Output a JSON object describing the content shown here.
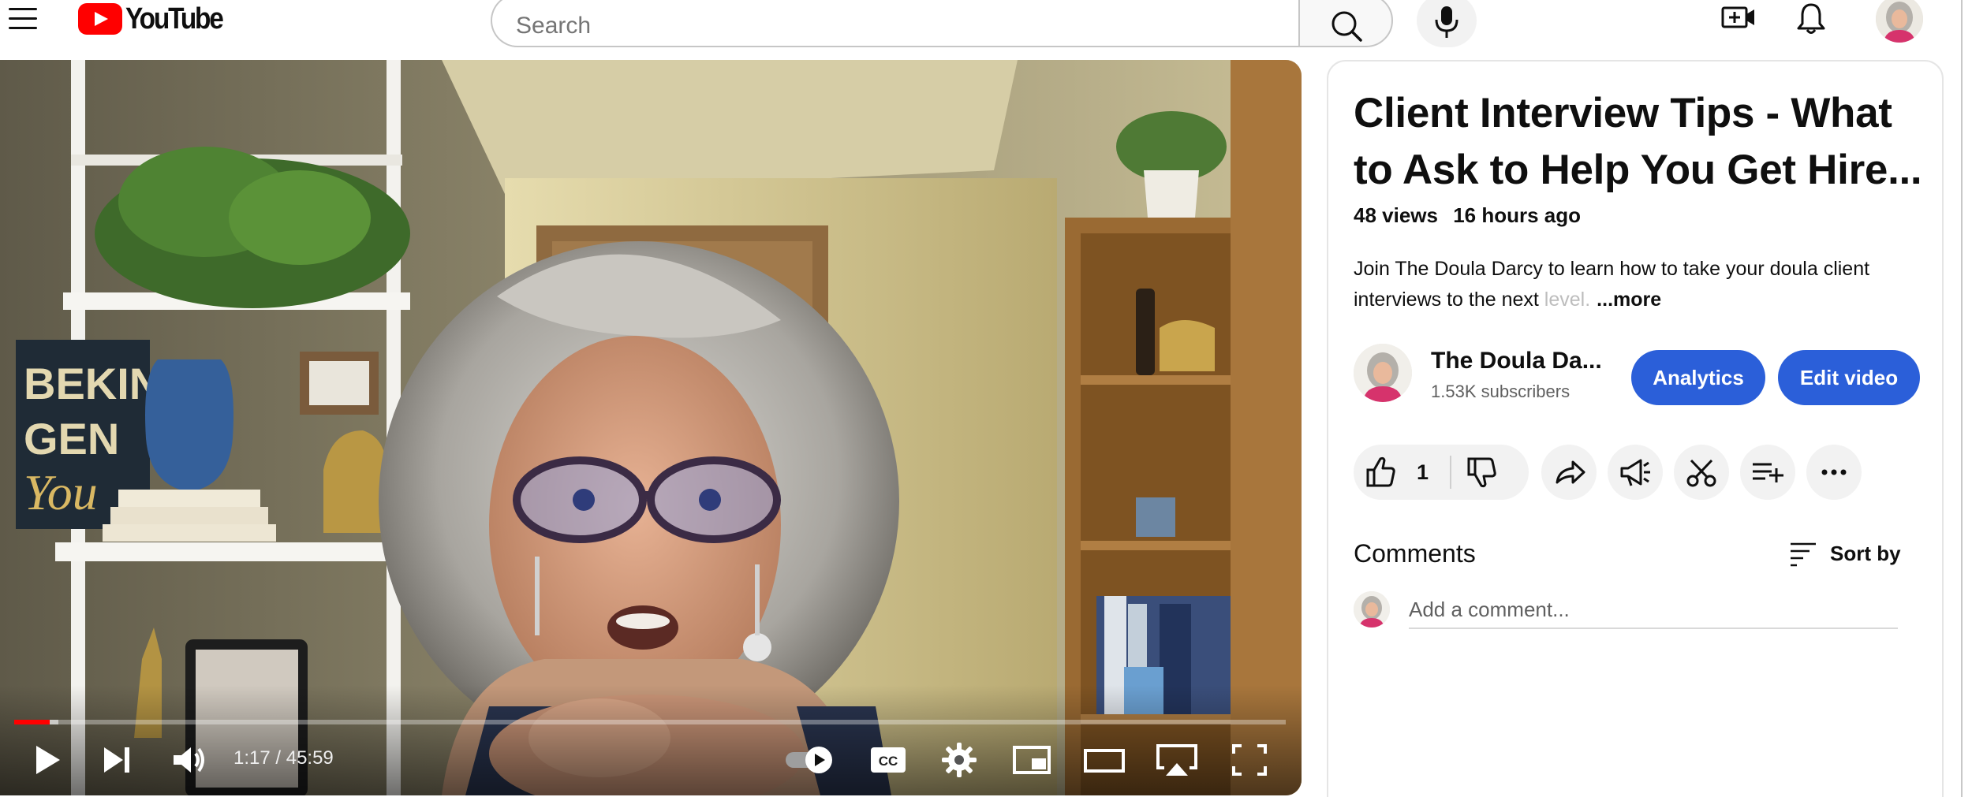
{
  "app": {
    "logo_text": "YouTube",
    "accent_color": "#ff0000",
    "brand_button_color": "#2b5fd9"
  },
  "header": {
    "search": {
      "placeholder": "Search",
      "value": ""
    },
    "icons": [
      "menu-icon",
      "search-icon",
      "microphone-icon",
      "create-video-icon",
      "notifications-bell-icon",
      "account-avatar"
    ]
  },
  "player": {
    "current_time": "1:17",
    "duration": "45:59",
    "time_display": "1:17 / 45:59",
    "played_fraction": 0.028,
    "buffered_fraction": 0.035,
    "autoplay_on": true,
    "controls": [
      "play-icon",
      "next-icon",
      "volume-icon",
      "autoplay-toggle",
      "captions-icon",
      "settings-gear-icon",
      "miniplayer-icon",
      "theater-mode-icon",
      "airplay-icon",
      "fullscreen-icon"
    ],
    "captions_label": "CC"
  },
  "video": {
    "title_line1": "Client Interview Tips - What",
    "title_line2": "to Ask to Help You Get Hire...",
    "views": "48 views",
    "uploaded": "16 hours ago",
    "description_visible": "Join The Doula Darcy to learn how to take your doula client interviews to the next ",
    "description_faded": "level.",
    "description_more": "...more"
  },
  "channel": {
    "name": "The Doula Da...",
    "subscribers": "1.53K subscribers",
    "analytics_label": "Analytics",
    "edit_label": "Edit video"
  },
  "actions": {
    "like_count": "1",
    "buttons": [
      "like-icon",
      "dislike-icon",
      "share-icon",
      "promote-icon",
      "clip-icon",
      "save-to-playlist-icon",
      "more-icon"
    ]
  },
  "comments": {
    "heading": "Comments",
    "sort_label": "Sort by",
    "add_placeholder": "Add a comment..."
  }
}
